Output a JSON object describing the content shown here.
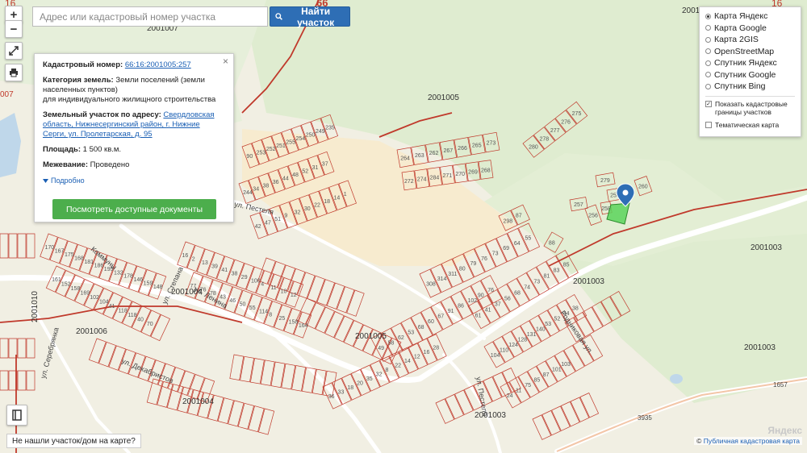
{
  "search": {
    "placeholder": "Адрес или кадастровый номер участка",
    "button_label": "Найти участок"
  },
  "controls": {
    "zoom_in": "+",
    "zoom_out": "−"
  },
  "info_card": {
    "cad_label": "Кадастровый номер:",
    "cad_value": "66:16:2001005:257",
    "category_label": "Категория земель:",
    "category_value": "Земли поселений (земли населенных пунктов)",
    "use_value": "для индивидуального жилищного строительства",
    "address_label": "Земельный участок по адресу:",
    "address_value": "Свердловская область, Нижнесергинский район, г. Нижние Серги, ул. Пролетарская, д. 95",
    "area_label": "Площадь:",
    "area_value": "1 500 кв.м.",
    "survey_label": "Межевание:",
    "survey_value": "Проведено",
    "more_link": "Подробно",
    "docs_button": "Посмотреть доступные документы",
    "close": "×"
  },
  "layers": {
    "options": [
      {
        "label": "Карта Яндекс",
        "selected": true
      },
      {
        "label": "Карта Google",
        "selected": false
      },
      {
        "label": "Карта 2GIS",
        "selected": false
      },
      {
        "label": "OpenStreetMap",
        "selected": false
      },
      {
        "label": "Спутник Яндекс",
        "selected": false
      },
      {
        "label": "Спутник Google",
        "selected": false
      },
      {
        "label": "Спутник Bing",
        "selected": false
      }
    ],
    "checkboxes": [
      {
        "label": "Показать кадастровые границы участков",
        "checked": true
      },
      {
        "label": "Тематическая карта",
        "checked": false
      }
    ]
  },
  "not_found": "Не нашли участок/дом на карте?",
  "attribution": {
    "prefix": "©",
    "link": "Публичная кадастровая карта"
  },
  "provider_logo": "Яндекс",
  "map_labels": {
    "block_2001005_a": "2001005",
    "block_2001005_b": "2001005",
    "block_2001003_a": "2001003",
    "block_2001003_b": "2001003",
    "block_2001003_c": "2001003",
    "block_2001003_d": "2001003",
    "block_2001004_a": "2001004",
    "block_2001004_b": "2001004",
    "block_2001006": "2001006",
    "block_2001007": "2001007",
    "block_2001010": "2001010",
    "block_2001001": "2001001",
    "street_pestelya_1": "ул. Пестеля",
    "street_pestelya_2": "ул. Пестеля",
    "street_komuny": "Коммуны",
    "street_stepana": "ул. Степана",
    "street_dekabristov": "ул. Декабристов",
    "street_serebryanka": "ул. Серебрянка",
    "street_rodnikovaya": "Родниковая ул.",
    "street_lenina": "ул. Ленина",
    "road_1657": "1657",
    "road_3935": "3935",
    "edge_16_left": "16",
    "edge_16_right": "16",
    "edge_66": "66",
    "edge_007": "007"
  },
  "plots_top": [
    "264",
    "263",
    "262",
    "267",
    "266",
    "265",
    "273",
    "272",
    "274",
    "284",
    "271",
    "270",
    "269",
    "268",
    "280",
    "278",
    "277",
    "276",
    "275",
    "279",
    "259",
    "258",
    "257",
    "256",
    "260",
    "298",
    "87",
    "88",
    "296"
  ],
  "plots_left": [
    "90",
    "253",
    "252",
    "251",
    "255",
    "254",
    "250",
    "249",
    "235",
    "244",
    "34",
    "38",
    "36",
    "44",
    "48",
    "52",
    "31",
    "37",
    "42",
    "47",
    "51",
    "9",
    "32",
    "30",
    "22",
    "18",
    "14",
    "1",
    "16",
    "2",
    "13",
    "39",
    "41",
    "38",
    "29",
    "100",
    "4",
    "11",
    "10",
    "12",
    "77",
    "76",
    "78",
    "43",
    "46",
    "50",
    "55",
    "114",
    "8",
    "25",
    "158",
    "164",
    "170",
    "167",
    "175",
    "168",
    "181",
    "186",
    "195",
    "132",
    "178",
    "146",
    "159",
    "148",
    "161",
    "152",
    "158",
    "169",
    "102",
    "104",
    "41",
    "118",
    "118",
    "40",
    "70"
  ],
  "plots_right": [
    "308",
    "314",
    "311",
    "80",
    "79",
    "76",
    "73",
    "69",
    "64",
    "55",
    "61",
    "41",
    "37",
    "56",
    "68",
    "74",
    "73",
    "81",
    "83",
    "85",
    "49",
    "58",
    "62",
    "53",
    "68",
    "60",
    "67",
    "91",
    "86",
    "102",
    "90",
    "76",
    "104",
    "110",
    "124",
    "128",
    "131",
    "140",
    "53",
    "52",
    "44",
    "38",
    "36",
    "33",
    "18",
    "20",
    "35",
    "32",
    "8",
    "22",
    "14",
    "12",
    "16",
    "28",
    "24",
    "11",
    "75",
    "85",
    "87",
    "101",
    "103"
  ]
}
